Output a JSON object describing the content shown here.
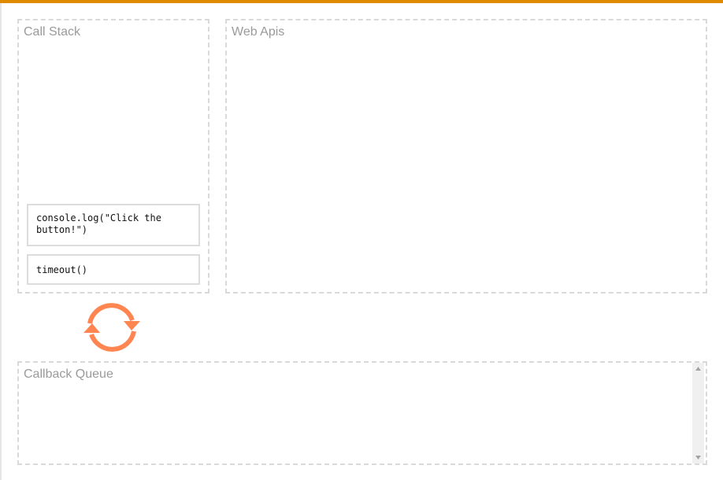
{
  "panels": {
    "call_stack": {
      "title": "Call Stack",
      "frames": [
        "console.log(\"Click the button!\")",
        "timeout()"
      ]
    },
    "web_apis": {
      "title": "Web Apis"
    },
    "callback_queue": {
      "title": "Callback Queue"
    }
  },
  "event_loop": {
    "icon": "refresh-icon",
    "color": "#ff8551"
  },
  "colors": {
    "accent_top_bar": "#e08a00",
    "panel_border": "#d9d9d9",
    "title_text": "#9a9a9a"
  }
}
